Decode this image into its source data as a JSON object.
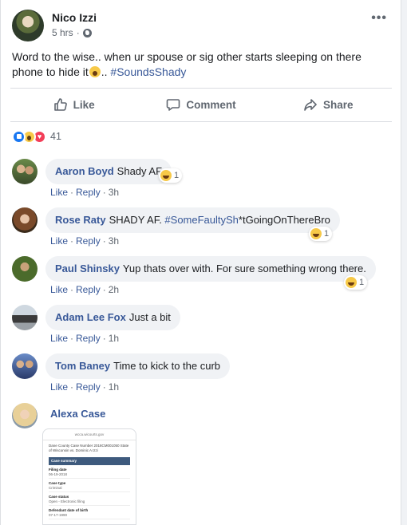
{
  "post": {
    "author": "Nico Izzi",
    "time": "5 hrs",
    "text_parts": [
      "Word to the wise.. when ur spouse or sig other starts sleeping on there phone to hide it",
      ".. "
    ],
    "hashtag": "#SoundsShady",
    "more_label": "•••"
  },
  "actions": {
    "like": "Like",
    "comment": "Comment",
    "share": "Share"
  },
  "reactions": {
    "count": "41",
    "types": [
      "like-icon",
      "wow-icon",
      "love-icon"
    ]
  },
  "comments": [
    {
      "name": "Aaron Boyd",
      "text": "Shady AF",
      "like": "Like",
      "reply": "Reply",
      "time": "3h",
      "reaction_count": "1"
    },
    {
      "name": "Rose Raty",
      "text_pre": "SHADY AF. ",
      "hashtag": "#SomeFaultySh",
      "text_post": "*tGoingOnThereBro",
      "like": "Like",
      "reply": "Reply",
      "time": "3h",
      "reaction_count": "1"
    },
    {
      "name": "Paul Shinsky",
      "text": "Yup thats over with. For sure something wrong there.",
      "like": "Like",
      "reply": "Reply",
      "time": "2h",
      "reaction_count": "1"
    },
    {
      "name": "Adam Lee Fox",
      "text": "Just a bit",
      "like": "Like",
      "reply": "Reply",
      "time": "1h"
    },
    {
      "name": "Tom Baney",
      "text": "Time to kick to the curb",
      "like": "Like",
      "reply": "Reply",
      "time": "1h"
    },
    {
      "name": "Alexa Case"
    }
  ],
  "attachment": {
    "url": "wcca.wicourts.gov",
    "title": "Dane County Case Number 2018CM001050 State of Wisconsin vs. Dominic A Izzi",
    "section": "Case summary",
    "fields": [
      {
        "label": "Filing date",
        "value": "06-19-2018"
      },
      {
        "label": "Case type",
        "value": "Criminal"
      },
      {
        "label": "Case status",
        "value": "Open - Electronic filing"
      },
      {
        "label": "Defendant date of birth",
        "value": "07-17-1990"
      }
    ]
  },
  "colors": {
    "link": "#385898",
    "bubble": "#f0f2f5",
    "muted": "#606770",
    "brand": "#1877f2"
  }
}
